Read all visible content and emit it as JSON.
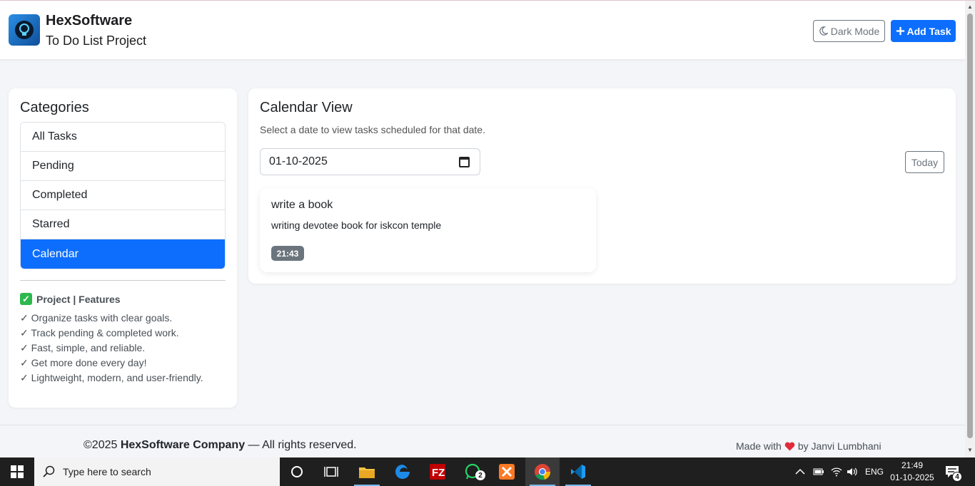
{
  "header": {
    "brand": "HexSoftware",
    "subtitle": "To Do List Project",
    "dark_mode_label": "Dark Mode",
    "add_task_label": "Add Task"
  },
  "sidebar": {
    "title": "Categories",
    "items": [
      {
        "label": "All Tasks",
        "active": false
      },
      {
        "label": "Pending",
        "active": false
      },
      {
        "label": "Completed",
        "active": false
      },
      {
        "label": "Starred",
        "active": false
      },
      {
        "label": "Calendar",
        "active": true
      }
    ],
    "features_title": "Project | Features",
    "features": [
      "✓ Organize tasks with clear goals.",
      "✓ Track pending & completed work.",
      "✓ Fast, simple, and reliable.",
      "✓ Get more done every day!",
      "✓ Lightweight, modern, and user-friendly."
    ]
  },
  "main": {
    "title": "Calendar View",
    "help": "Select a date to view tasks scheduled for that date.",
    "date_value": "01-10-2025",
    "today_label": "Today",
    "task": {
      "title": "write a book",
      "description": "writing devotee book for iskcon temple",
      "time": "21:43"
    }
  },
  "footer": {
    "copyright_prefix": "©2025 ",
    "company": "HexSoftware Company",
    "copyright_suffix": " — All rights reserved.",
    "made_with": "Made with",
    "by": "by Janvi Lumbhani"
  },
  "taskbar": {
    "search_placeholder": "Type here to search",
    "whatsapp_badge": "2",
    "language": "ENG",
    "time": "21:49",
    "date": "01-10-2025",
    "notification_count": "4"
  },
  "colors": {
    "primary": "#0d6efd",
    "secondary": "#6c757d",
    "page_bg": "#f3f5f8"
  }
}
